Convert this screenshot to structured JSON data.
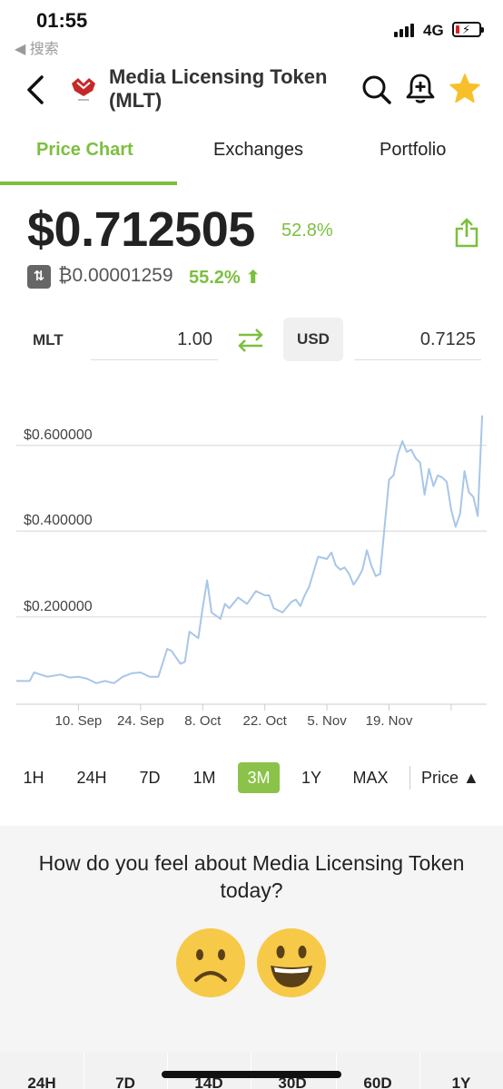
{
  "status_bar": {
    "time": "01:55",
    "back_app": "◀ 搜索",
    "network": "4G"
  },
  "header": {
    "coin_name": "Media Licensing Token (MLT)"
  },
  "tabs": [
    {
      "label": "Price Chart",
      "active": true
    },
    {
      "label": "Exchanges",
      "active": false
    },
    {
      "label": "Portfolio",
      "active": false
    }
  ],
  "price": {
    "usd": "$0.712505",
    "usd_change": "52.8%",
    "btc": "₿0.00001259",
    "btc_change": "55.2% ⬆"
  },
  "converter": {
    "from_symbol": "MLT",
    "from_value": "1.00",
    "to_symbol": "USD",
    "to_value": "0.7125"
  },
  "chart_data": {
    "type": "line",
    "x_tick_labels": [
      "10. Sep",
      "24. Sep",
      "8. Oct",
      "22. Oct",
      "5. Nov",
      "19. Nov"
    ],
    "y_tick_labels": [
      "$0.600000",
      "$0.400000",
      "$0.200000"
    ],
    "y_ticks": [
      0.6,
      0.4,
      0.2
    ],
    "ylim": [
      0.0,
      0.75
    ],
    "grid": true,
    "line_color": "#a8c6e8",
    "x_days": [
      0,
      3,
      4,
      7,
      10,
      12,
      14,
      16,
      18,
      20,
      22,
      24,
      26,
      28,
      30,
      32,
      34,
      35,
      37,
      38,
      39,
      41,
      42,
      43,
      44,
      46,
      47,
      48,
      50,
      52,
      54,
      56,
      57,
      58,
      60,
      62,
      63,
      64,
      65,
      66,
      68,
      70,
      71,
      72,
      73,
      74,
      75,
      76,
      77,
      78,
      79,
      80,
      81,
      82,
      84,
      85,
      86,
      87,
      88,
      89,
      90,
      91,
      92,
      93,
      94,
      95,
      96,
      97,
      98,
      99,
      100,
      101,
      102,
      103,
      104,
      105
    ],
    "values": [
      0.05,
      0.05,
      0.07,
      0.06,
      0.065,
      0.058,
      0.06,
      0.055,
      0.045,
      0.05,
      0.045,
      0.06,
      0.068,
      0.07,
      0.06,
      0.06,
      0.125,
      0.12,
      0.09,
      0.095,
      0.165,
      0.15,
      0.22,
      0.285,
      0.21,
      0.195,
      0.23,
      0.22,
      0.245,
      0.23,
      0.26,
      0.25,
      0.25,
      0.22,
      0.21,
      0.235,
      0.24,
      0.225,
      0.25,
      0.27,
      0.34,
      0.335,
      0.35,
      0.32,
      0.31,
      0.315,
      0.3,
      0.275,
      0.29,
      0.31,
      0.355,
      0.32,
      0.295,
      0.3,
      0.52,
      0.53,
      0.58,
      0.61,
      0.585,
      0.59,
      0.57,
      0.56,
      0.485,
      0.545,
      0.505,
      0.53,
      0.525,
      0.515,
      0.45,
      0.41,
      0.44,
      0.54,
      0.49,
      0.48,
      0.435,
      0.67
    ],
    "x_tick_days": [
      14,
      28,
      42,
      56,
      70,
      84,
      98
    ],
    "x_range_days": [
      0,
      106
    ]
  },
  "ranges": {
    "items": [
      "1H",
      "24H",
      "7D",
      "1M",
      "3M",
      "1Y",
      "MAX"
    ],
    "active": "3M",
    "metric": "Price ▲"
  },
  "sentiment": {
    "question": "How do you feel about Media Licensing Token today?"
  },
  "stats_strip": [
    "24H",
    "7D",
    "14D",
    "30D",
    "60D",
    "1Y"
  ],
  "colors": {
    "accent": "#7cbf3f",
    "active_range": "#8bc34a",
    "emoji_yellow": "#f7c948"
  }
}
